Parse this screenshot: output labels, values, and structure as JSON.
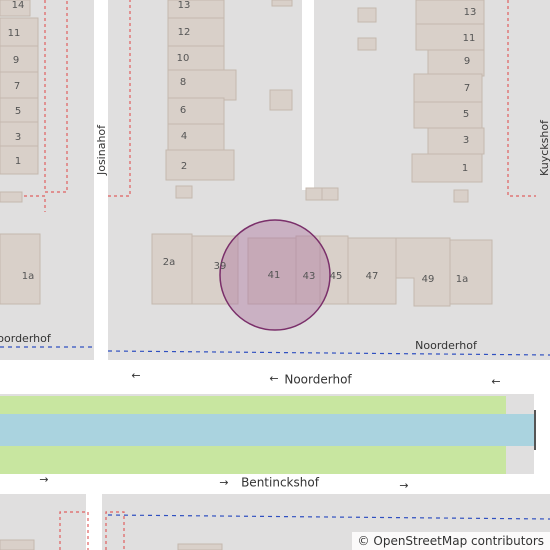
{
  "map": {
    "buildings_left_col": [
      "14",
      "11",
      "9",
      "7",
      "5",
      "3",
      "1"
    ],
    "buildings_mid_col": [
      "13",
      "12",
      "10",
      "8",
      "6",
      "4",
      "2"
    ],
    "buildings_right_col": [
      "13",
      "11",
      "9",
      "7",
      "5",
      "3",
      "1"
    ],
    "building_row": [
      "2a",
      "39",
      "41",
      "43",
      "45",
      "47",
      "49",
      "1a"
    ],
    "building_far_left": "1a",
    "streets": {
      "josinahof": "Josinahof",
      "kuyckshof": "Kuyckshof",
      "noorderhof_left": "oorderhof",
      "noorderhof_right": "Noorderhof",
      "noorderhof_main": "Noorderhof",
      "bentinckshof": "Bentinckshof"
    },
    "oneway_arrow_left": "←",
    "oneway_arrow_right": "→",
    "highlight_color": "#b07aa1",
    "colors": {
      "landuse": "#e0dfdf",
      "building": "#d9d0c9",
      "water": "#aad3df",
      "grass": "#c8e6a0",
      "road": "#ffffff"
    }
  },
  "attribution": {
    "symbol": "©",
    "text": "OpenStreetMap contributors"
  }
}
